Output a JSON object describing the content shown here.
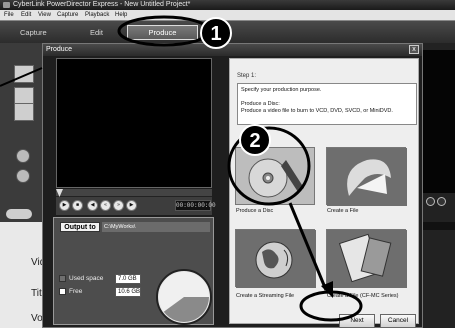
{
  "app": {
    "title": "CyberLink PowerDirector Express - New Untitled Project*",
    "menu": [
      "File",
      "Edit",
      "View",
      "Capture",
      "Playback",
      "Help"
    ],
    "modes": [
      "Capture",
      "Edit",
      "Produce"
    ],
    "active_mode": "Produce",
    "timeline_rows": [
      "Vid",
      "Titl",
      "Voi"
    ]
  },
  "dialog": {
    "title": "Produce",
    "close_glyph": "x",
    "timecode": "00:00:00:00",
    "output": {
      "button_label": "Output to",
      "path": "C:\\MyWorks\\",
      "used_space_label": "Used space",
      "used_space_value": "7.0 GB",
      "free_label": "Free",
      "free_value": "10.6 GB",
      "used_fraction": 0.4
    },
    "step": {
      "label": "Step 1:",
      "line1": "Specify your production purpose.",
      "line2": "Produce a Disc:",
      "line3": "Produce a video file to burn to VCD, DVD, SVCD, or MiniDVD."
    },
    "options": [
      {
        "label": "Produce a Disc"
      },
      {
        "label": "Create a File"
      },
      {
        "label": "Create a Streaming File"
      },
      {
        "label": "Create a File (CF-MC Series)"
      }
    ],
    "buttons": {
      "next": "Next",
      "cancel": "Cancel"
    }
  },
  "callouts": [
    "1",
    "2"
  ]
}
